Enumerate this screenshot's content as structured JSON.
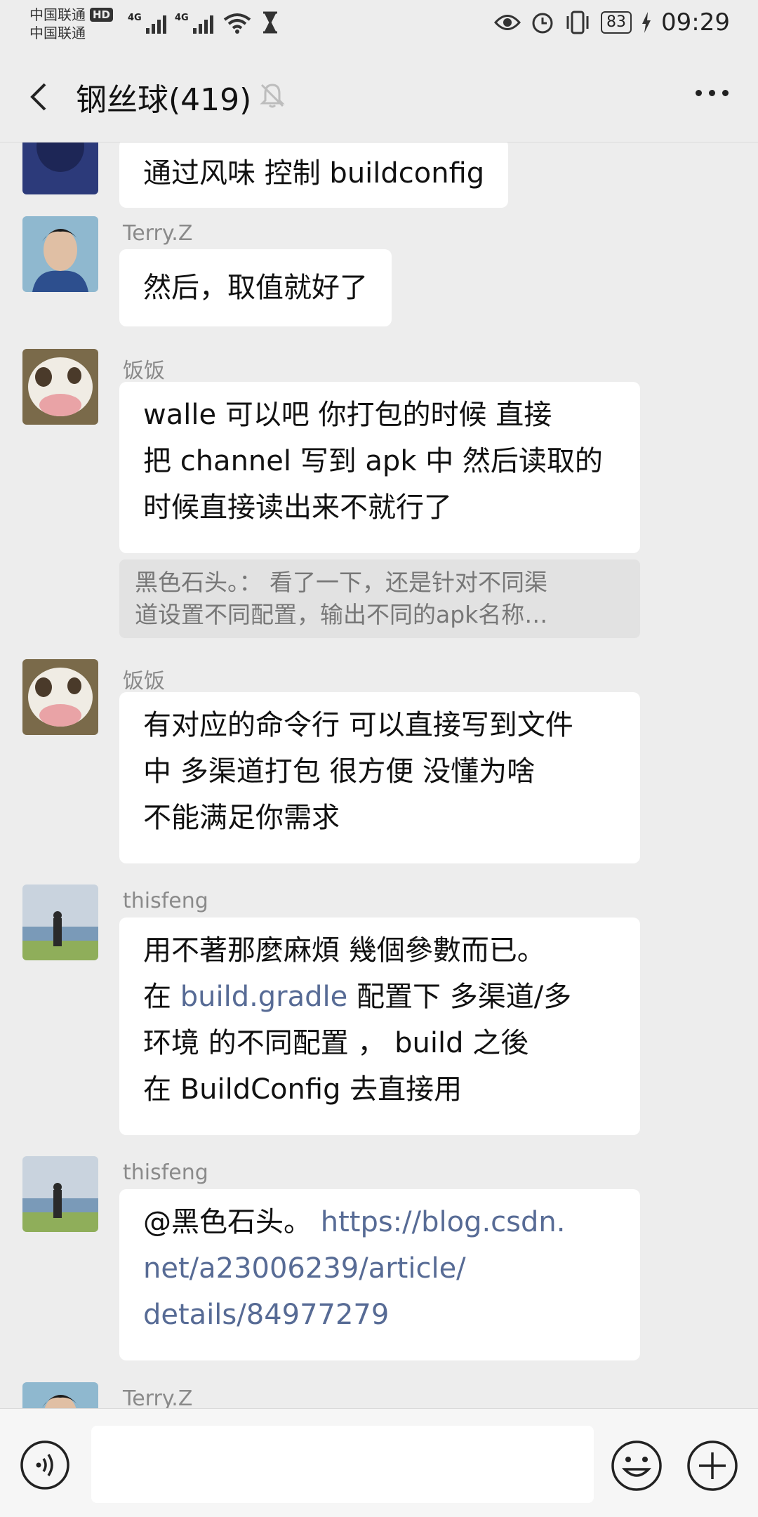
{
  "status_bar": {
    "carrier1": "中国联通",
    "carrier2": "中国联通",
    "hd": "HD",
    "net1": "4G",
    "net2": "4G",
    "battery": "83",
    "time": "09:29"
  },
  "header": {
    "title": "钢丝球(419)"
  },
  "messages": [
    {
      "sender": "",
      "text": "通过风味 控制 buildconfig"
    },
    {
      "sender": "Terry.Z",
      "text": "然后，取值就好了"
    },
    {
      "sender": "饭饭",
      "lines": [
        "walle  可以吧  你打包的时候 直接",
        "把 channel 写到 apk 中  然后读取的",
        "时候直接读出来不就行了"
      ],
      "quote_lines": [
        "黑色石头。：  看了一下，还是针对不同渠",
        "道设置不同配置，输出不同的apk名称…"
      ]
    },
    {
      "sender": "饭饭",
      "lines": [
        "有对应的命令行 可以直接写到文件",
        "中  多渠道打包   很方便  没懂为啥",
        "不能满足你需求"
      ]
    },
    {
      "sender": "thisfeng",
      "line1": "用不著那麼麻煩 幾個參數而已。",
      "line2_pre": "在 ",
      "line2_link": "build.gradle",
      "line2_post": " 配置下 多渠道/多",
      "line3": "环境 的不同配置   ，  build 之後",
      "line4": "在  BuildConfig 去直接用"
    },
    {
      "sender": "thisfeng",
      "mention": "@黑色石头。 ",
      "link1": "https://blog.csdn.",
      "link2": "net/a23006239/article/",
      "link3": "details/84977279"
    },
    {
      "sender": "Terry.Z"
    }
  ],
  "icons": {
    "back": "back-arrow-icon",
    "mute": "bell-off-icon",
    "more": "more-dots-icon",
    "voice": "voice-icon",
    "emoji": "emoji-icon",
    "plus": "plus-icon"
  },
  "colors": {
    "background": "#ededed",
    "bubble": "#ffffff",
    "link": "#576b95",
    "sender": "#8a8a8a"
  }
}
